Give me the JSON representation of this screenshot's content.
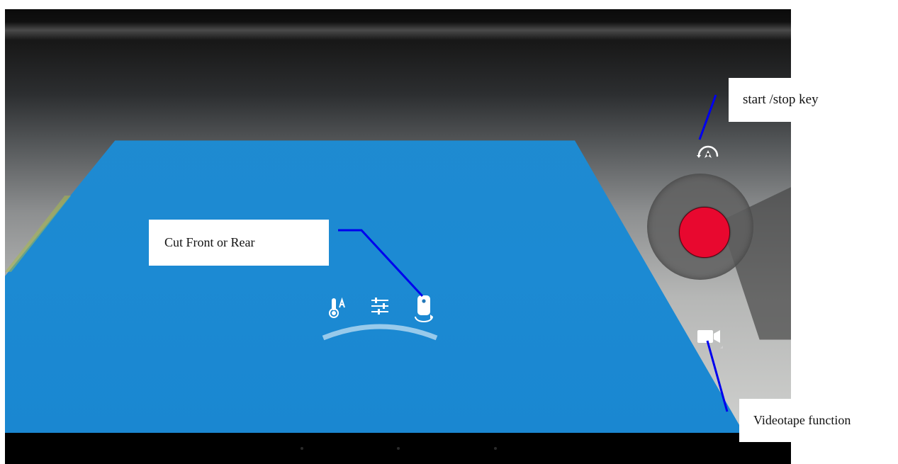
{
  "annotations": {
    "start_stop_key": "start /stop key",
    "cut_front_or_rear": "Cut Front or Rear",
    "videotape_function": "Videotape function"
  },
  "icons": {
    "switch_mode": "camera-switch-mode-icon",
    "white_balance": "white-balance-auto-icon",
    "settings_sliders": "settings-sliders-icon",
    "camera_flip": "front-rear-camera-switch-icon",
    "video_mode": "video-camera-icon"
  },
  "colors": {
    "shutter_red": "#e8082f",
    "callout_line": "#0000ee",
    "callout_box": "#ffffff"
  }
}
